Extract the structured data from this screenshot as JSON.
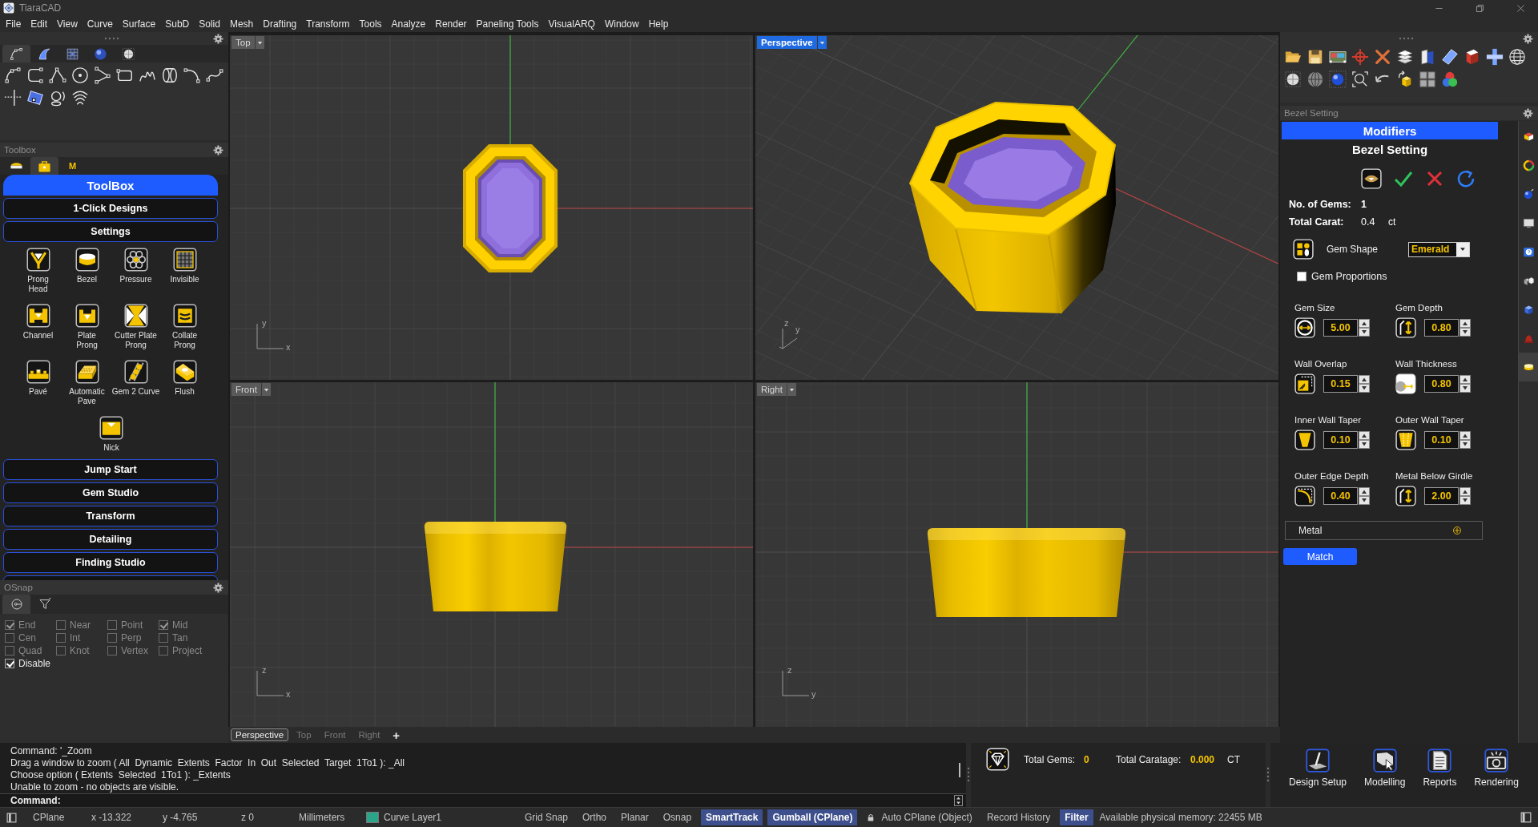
{
  "window": {
    "title": "TiaraCAD"
  },
  "menu": [
    "File",
    "Edit",
    "View",
    "Curve",
    "Surface",
    "SubD",
    "Solid",
    "Mesh",
    "Drafting",
    "Transform",
    "Tools",
    "Analyze",
    "Render",
    "Paneling Tools",
    "VisualARQ",
    "Window",
    "Help"
  ],
  "toolbar": {
    "tabs": [
      {
        "selected": true
      },
      {
        "selected": false
      },
      {
        "selected": false
      },
      {
        "selected": false
      },
      {
        "selected": false
      }
    ]
  },
  "toolbox": {
    "title": "Toolbox",
    "tabs": [
      {
        "kind": "icon",
        "selected": false
      },
      {
        "kind": "icon",
        "selected": true
      },
      {
        "kind": "text",
        "label": "M",
        "selected": false
      }
    ],
    "header": "ToolBox",
    "top_buttons": [
      "1-Click Designs",
      "Settings"
    ],
    "tools": [
      {
        "label": "Prong\nHead"
      },
      {
        "label": "Bezel"
      },
      {
        "label": "Pressure"
      },
      {
        "label": "Invisible"
      },
      {
        "label": "Channel"
      },
      {
        "label": "Plate\nProng"
      },
      {
        "label": "Cutter Plate\nProng"
      },
      {
        "label": "Collate\nProng"
      },
      {
        "label": "Pavé"
      },
      {
        "label": "Automatic\nPave"
      },
      {
        "label": "Gem 2 Curve"
      },
      {
        "label": "Flush"
      },
      {
        "label": "Nick"
      }
    ],
    "sections": [
      "Jump Start",
      "Gem Studio",
      "Transform",
      "Detailing",
      "Finding Studio"
    ]
  },
  "osnap": {
    "title": "OSnap",
    "tabs": [
      {
        "selected": true
      },
      {
        "selected": false
      }
    ],
    "options": [
      {
        "label": "End",
        "checked": true,
        "disabled": true
      },
      {
        "label": "Near",
        "checked": false,
        "disabled": true
      },
      {
        "label": "Point",
        "checked": false,
        "disabled": true
      },
      {
        "label": "Mid",
        "checked": true,
        "disabled": true
      },
      {
        "label": "Cen",
        "checked": false,
        "disabled": true
      },
      {
        "label": "Int",
        "checked": false,
        "disabled": true
      },
      {
        "label": "Perp",
        "checked": false,
        "disabled": true
      },
      {
        "label": "Tan",
        "checked": false,
        "disabled": true
      },
      {
        "label": "Quad",
        "checked": false,
        "disabled": true
      },
      {
        "label": "Knot",
        "checked": false,
        "disabled": true
      },
      {
        "label": "Vertex",
        "checked": false,
        "disabled": true
      },
      {
        "label": "Project",
        "checked": false,
        "disabled": true
      },
      {
        "label": "Disable",
        "checked": true,
        "disabled": false
      }
    ]
  },
  "viewports": [
    {
      "label": "Top",
      "kind": "plan",
      "selected": false,
      "axes": [
        "y",
        "x"
      ]
    },
    {
      "label": "Perspective",
      "kind": "perspective",
      "selected": true,
      "axes": [
        "z",
        "y"
      ]
    },
    {
      "label": "Front",
      "kind": "front",
      "selected": false,
      "axes": [
        "z",
        "x"
      ]
    },
    {
      "label": "Right",
      "kind": "side",
      "selected": false,
      "axes": [
        "z",
        "y"
      ]
    }
  ],
  "viewport_tabs": {
    "tabs": [
      {
        "label": "Perspective",
        "selected": true
      },
      {
        "label": "Top",
        "selected": false
      },
      {
        "label": "Front",
        "selected": false
      },
      {
        "label": "Right",
        "selected": false
      }
    ],
    "add": "+"
  },
  "command": {
    "history": [
      "Command: '_Zoom",
      "Drag a window to zoom ( All  Dynamic  Extents  Factor  In  Out  Selected  Target  1To1 ): _All",
      "Choose option ( Extents  Selected  1To1 ): _Extents",
      "Unable to zoom - no objects are visible."
    ],
    "prompt": "Command:"
  },
  "gem_summary": {
    "gems_label": "Total Gems:",
    "gems": "0",
    "carat_label": "Total Caratage:",
    "carat": "0.000",
    "unit": "CT"
  },
  "nav_buttons": [
    "Design Setup",
    "Modelling",
    "Reports",
    "Rendering"
  ],
  "status_bar": {
    "cplane": "CPlane",
    "x": "x -13.322",
    "y": "y -4.765",
    "z": "z 0",
    "units": "Millimeters",
    "layer": {
      "name": "Curve Layer1",
      "color": "#2aa58a"
    },
    "toggles": [
      {
        "label": "Grid Snap",
        "on": false,
        "locked": false
      },
      {
        "label": "Ortho",
        "on": false,
        "locked": false
      },
      {
        "label": "Planar",
        "on": false,
        "locked": false
      },
      {
        "label": "Osnap",
        "on": false,
        "locked": false
      },
      {
        "label": "SmartTrack",
        "on": true,
        "locked": false
      },
      {
        "label": "Gumball (CPlane)",
        "on": true,
        "locked": false
      },
      {
        "label": "Auto CPlane (Object)",
        "on": false,
        "locked": true
      },
      {
        "label": "Record History",
        "on": false,
        "locked": false
      },
      {
        "label": "Filter",
        "on": true,
        "locked": false
      }
    ],
    "memory": "Available physical memory: 22455 MB"
  },
  "right_panel": {
    "title": "Bezel Setting",
    "header": "Modifiers",
    "heading": "Bezel Setting",
    "stats": [
      {
        "label": "No. of Gems:",
        "value": "1"
      },
      {
        "label": "Total Carat:",
        "value": "0.4",
        "unit": "ct"
      }
    ],
    "gem_shape": {
      "label": "Gem Shape",
      "value": "Emerald"
    },
    "proportions": {
      "label": "Gem Proportions",
      "checked": false
    },
    "params": [
      {
        "label": "Gem Size",
        "value": "5.00"
      },
      {
        "label": "Gem Depth",
        "value": "0.80"
      },
      {
        "label": "Wall Overlap",
        "value": "0.15"
      },
      {
        "label": "Wall Thickness",
        "value": "0.80"
      },
      {
        "label": "Inner Wall Taper",
        "value": "0.10"
      },
      {
        "label": "Outer Wall Taper",
        "value": "0.10"
      },
      {
        "label": "Outer Edge Depth",
        "value": "0.40"
      },
      {
        "label": "Metal Below Girdle",
        "value": "2.00"
      }
    ],
    "metal": {
      "label": "Metal",
      "expanded": false
    },
    "match": "Match",
    "side_tabs": [
      {
        "selected": false
      },
      {
        "selected": false
      },
      {
        "selected": false
      },
      {
        "selected": false
      },
      {
        "selected": false
      },
      {
        "selected": false
      },
      {
        "selected": false
      },
      {
        "selected": false
      },
      {
        "selected": true
      }
    ]
  }
}
